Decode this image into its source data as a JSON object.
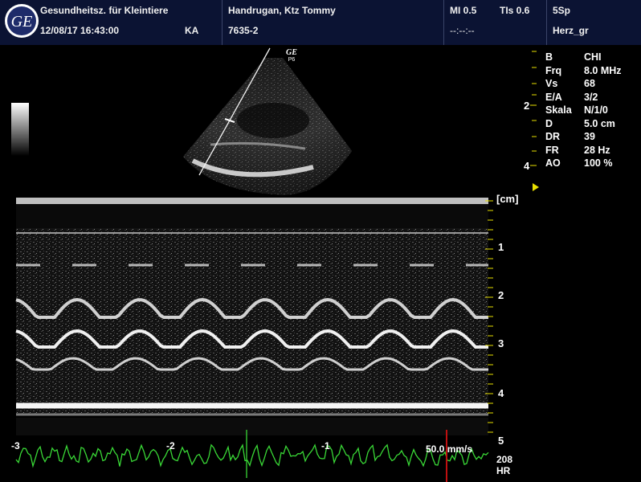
{
  "header": {
    "institution": "Gesundheitsz. für Kleintiere",
    "datetime": "12/08/17 16:43:00",
    "operator": "KA",
    "patient": "Handrugan, Ktz Tommy",
    "patient_id": "7635-2",
    "mi": "MI 0.5",
    "tis": "TIs 0.6",
    "probe": "5Sp",
    "time_placeholder": "--:--:--",
    "preset": "Herz_gr"
  },
  "probe_mark": {
    "brand": "GE",
    "code": "P6"
  },
  "params": [
    {
      "key": "B",
      "value": "CHI"
    },
    {
      "key": "Frq",
      "value": "8.0 MHz"
    },
    {
      "key": "Vs",
      "value": "68"
    },
    {
      "key": "E/A",
      "value": "3/2"
    },
    {
      "key": "Skala",
      "value": "N/1/0"
    },
    {
      "key": "D",
      "value": "5.0 cm"
    },
    {
      "key": "DR",
      "value": "39"
    },
    {
      "key": "FR",
      "value": "28 Hz"
    },
    {
      "key": "AO",
      "value": "100 %"
    }
  ],
  "bmode_depth_labels": [
    "2",
    "4"
  ],
  "mmode": {
    "unit": "[cm]",
    "depth_labels": [
      "1",
      "2",
      "3",
      "4",
      "5"
    ],
    "time_labels": [
      "-3",
      "-2",
      "-1"
    ],
    "sweep_speed": "50.0 mm/s",
    "hr_value": "208",
    "hr_label": "HR"
  },
  "colors": {
    "header_bg": "#0b1333",
    "ecg": "#39d836",
    "marker": "#e8e000",
    "cursor": "#c01010"
  }
}
